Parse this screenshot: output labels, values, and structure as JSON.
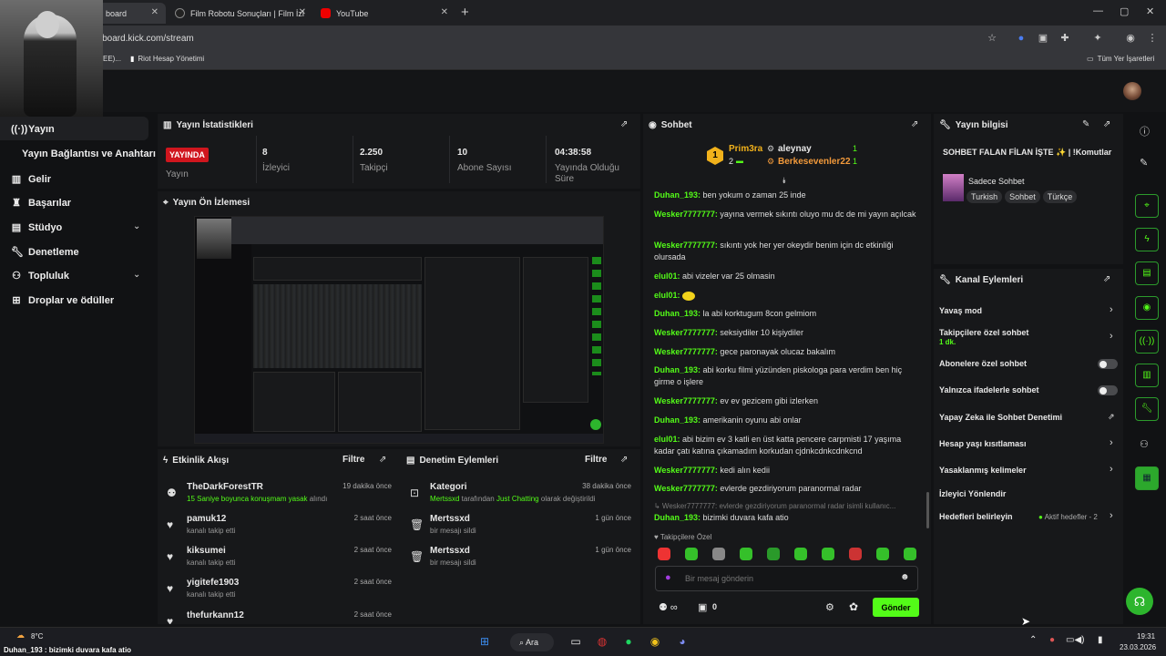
{
  "browser": {
    "tabs": [
      {
        "label": "board"
      },
      {
        "label": "Film Robotu Sonuçları | Film İzl"
      },
      {
        "label": "YouTube"
      }
    ],
    "new_tab": "+",
    "url": "ashboard.kick.com/stream",
    "bookmarks": [
      {
        "label": "EE)..."
      },
      {
        "label": "Riot Hesap Yönetimi"
      }
    ],
    "all_bookmarks": "Tüm Yer İşaretleri"
  },
  "sidebar": {
    "items": [
      {
        "label": "Yayın"
      },
      {
        "label": "Yayın Bağlantısı ve Anahtarı"
      },
      {
        "label": "Gelir"
      },
      {
        "label": "Başarılar"
      },
      {
        "label": "Stüdyo"
      },
      {
        "label": "Denetleme"
      },
      {
        "label": "Topluluk"
      },
      {
        "label": "Droplar ve ödüller"
      }
    ]
  },
  "stats": {
    "title": "Yayın İstatistikleri",
    "live": "YAYINDA",
    "live_label": "Yayın",
    "viewers": "8",
    "viewers_label": "İzleyici",
    "followers": "2.250",
    "followers_label": "Takipçi",
    "subs": "10",
    "subs_label": "Abone Sayısı",
    "duration": "04:38:58",
    "duration_label": "Yayında Olduğu Süre"
  },
  "preview": {
    "title": "Yayın Ön İzlemesi"
  },
  "feed": {
    "title": "Etkinlik Akışı",
    "filter": "Filtre",
    "rows": [
      {
        "name": "TheDarkForestTR",
        "sub_green": "15 Saniye boyunca konuşmam yasak",
        "sub_rest": " alındı",
        "time": "19 dakika önce"
      },
      {
        "name": "pamuk12",
        "sub": "kanalı takip etti",
        "time": "2 saat önce"
      },
      {
        "name": "kiksumei",
        "sub": "kanalı takip etti",
        "time": "2 saat önce"
      },
      {
        "name": "yigitefe1903",
        "sub": "kanalı takip etti",
        "time": "2 saat önce"
      },
      {
        "name": "thefurkann12",
        "time": "2 saat önce"
      }
    ]
  },
  "mod": {
    "title": "Denetim Eylemleri",
    "filter": "Filtre",
    "rows": [
      {
        "name": "Kategori",
        "sub_a": "Mertssxd",
        "sub_b": " tarafından ",
        "sub_c": "Just Chatting",
        "sub_d": " olarak değiştirildi",
        "time": "38 dakika önce"
      },
      {
        "name": "Mertssxd",
        "sub": "bir mesajı sildi",
        "time": "1 gün önce"
      },
      {
        "name": "Mertssxd",
        "sub": "bir mesajı sildi",
        "time": "1 gün önce"
      }
    ]
  },
  "chat": {
    "title": "Sohbet",
    "top": [
      {
        "rank": "1",
        "name": "Prim3ra",
        "count": "2"
      },
      {
        "name": "aleynay",
        "count": "1"
      },
      {
        "name": "Berkesevenler22",
        "count": "1"
      }
    ],
    "messages": [
      {
        "user": "Duhan_193:",
        "text": "ben yokum o zaman 25 inde"
      },
      {
        "user": "Wesker7777777:",
        "text": "yayına vermek sıkıntı oluyo mu dc de mi yayın açılcak"
      },
      {
        "user": "Wesker7777777:",
        "text": "sıkıntı yok her yer okeydir benim için dc etkinliği olursada"
      },
      {
        "user": "elul01:",
        "text": "abi vizeler var 25 olmasin"
      },
      {
        "user": "elul01:",
        "text": ""
      },
      {
        "user": "Duhan_193:",
        "text": "la abi korktugum 8con gelmiom"
      },
      {
        "user": "Wesker7777777:",
        "text": "seksiydiler 10 kişiydiler"
      },
      {
        "user": "Wesker7777777:",
        "text": "gece paronayak olucaz bakalım"
      },
      {
        "user": "Duhan_193:",
        "text": "abi korku filmi yüzünden piskologa para verdim ben hiç girme o işlere"
      },
      {
        "user": "Wesker7777777:",
        "text": "ev ev gezicem gibi izlerken"
      },
      {
        "user": "Duhan_193:",
        "text": "amerikanin oyunu abi onlar"
      },
      {
        "user": "elul01:",
        "text": "abi bizim ev 3 katli en üst katta pencere carpmisti 17 yaşıma kadar çatı katına çıkamadım korkudan cjdnkcdnkcdnkcnd"
      },
      {
        "user": "Wesker7777777:",
        "text": "kedi alın kedii"
      },
      {
        "user": "Wesker7777777:",
        "text": "evlerde gezdiriyorum paranormal radar"
      },
      {
        "user": "",
        "text": "↳ Wesker7777777: evlerde gezdiriyorum paranormal radar isimli kullanıc..."
      },
      {
        "user": "Duhan_193:",
        "text": "bizimki duvara kafa atio"
      }
    ],
    "followers_only": "Takipçilere Özel",
    "input_placeholder": "Bir mesaj gönderin",
    "counter": "0",
    "send": "Gönder"
  },
  "info": {
    "title": "Yayın bilgisi",
    "stream_title": "SOHBET FALAN FİLAN İŞTE ✨ | !Komutlar",
    "category": "Sadece Sohbet",
    "tags": [
      "Turkish",
      "Sohbet",
      "Türkçe"
    ]
  },
  "actions": {
    "title": "Kanal Eylemleri",
    "items": [
      {
        "label": "Yavaş mod"
      },
      {
        "label": "Takipçilere özel sohbet",
        "sub": "1 dk."
      },
      {
        "label": "Abonelere özel sohbet"
      },
      {
        "label": "Yalnızca ifadelerle sohbet"
      },
      {
        "label": "Yapay Zeka ile Sohbet Denetimi"
      },
      {
        "label": "Hesap yaşı kısıtlaması"
      },
      {
        "label": "Yasaklanmış kelimeler"
      },
      {
        "label": "İzleyici Yönlendir"
      },
      {
        "label": "Hedefleri belirleyin",
        "badge": "Aktif hedefler - 2"
      }
    ]
  },
  "taskbar": {
    "weather": "8°C",
    "ticker": "Duhan_193 : bizimki duvara kafa atio",
    "search": "Ara",
    "time": "19:31",
    "date": "23.03.2026"
  },
  "colors": {
    "accent": "#53fc18",
    "live": "#d0161e",
    "bg": "#111214",
    "panel": "#17181a"
  }
}
